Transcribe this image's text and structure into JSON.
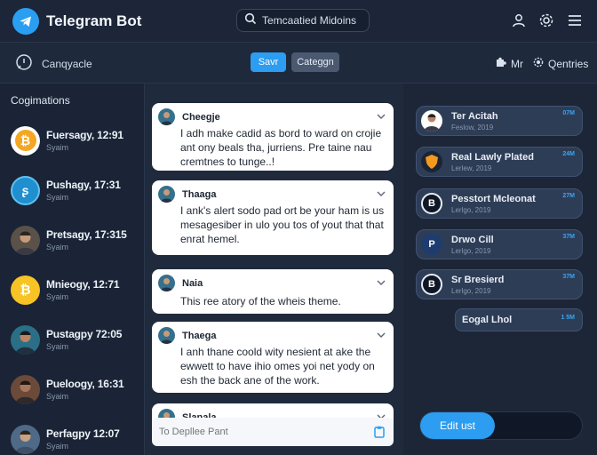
{
  "header": {
    "app_title": "Telegram Bot",
    "search_value": "Temcaatied Midoins",
    "icons": [
      "user-icon",
      "settings-icon",
      "menu-icon"
    ]
  },
  "subbar": {
    "label": "Canqyacle",
    "save_label": "Savr",
    "category_label": "Categgn",
    "mr_label": "Mr",
    "gentries_label": "Qentries"
  },
  "sidebar": {
    "title": "Cogimations",
    "items": [
      {
        "name": "Fuersagy, 12:91",
        "sub": "Syaim",
        "avatar": "coin"
      },
      {
        "name": "Pushagy, 17:31",
        "sub": "Syaim",
        "avatar": "logo"
      },
      {
        "name": "Pretsagy, 17:315",
        "sub": "Syaim",
        "avatar": "person"
      },
      {
        "name": "Mnieogy, 12:71",
        "sub": "Syaim",
        "avatar": "coin"
      },
      {
        "name": "Pustagpy 72:05",
        "sub": "Syaim",
        "avatar": "person"
      },
      {
        "name": "Pueloogy, 16:31",
        "sub": "Syaim",
        "avatar": "person"
      },
      {
        "name": "Perfagpy 12:07",
        "sub": "Syaim",
        "avatar": "person"
      }
    ]
  },
  "messages": [
    {
      "name": "Cheegje",
      "text": "I adh make cadid as bord to ward on crojie ant ony beals tha, jurriens. Pre taine nau cremtnes to tunge..!"
    },
    {
      "name": "Thaaga",
      "text": "I ank's alert sodo pad ort be your ham is us mesagesiber in ulo you tos of yout that that enrat hemel."
    },
    {
      "name": "Naia",
      "text": "This ree atory of the wheis theme."
    },
    {
      "name": "Thaega",
      "text": "I anh thane coold wity nesient at ake the ewwett to have ihio omes yoi net yody on esh the back ane of the work."
    },
    {
      "name": "Slanala",
      "text": ""
    }
  ],
  "composer": {
    "placeholder": "To Depllee Pant"
  },
  "right_panel": {
    "items": [
      {
        "title": "Ter Acitah",
        "sub": "Feslow, 2019",
        "time": "07M",
        "avatar": "person"
      },
      {
        "title": "Real Lawly Plated",
        "sub": "Lerlew, 2019",
        "time": "24M",
        "avatar": "shield"
      },
      {
        "title": "Pesstort Mcleonat",
        "sub": "Lerlgo, 2019",
        "time": "27M",
        "avatar": "letter-b"
      },
      {
        "title": "Drwo Cill",
        "sub": "Lerlgo, 2019",
        "time": "37M",
        "avatar": "letter-p"
      },
      {
        "title": "Sr Bresierd",
        "sub": "Lerlgo, 2019",
        "time": "37M",
        "avatar": "letter-b"
      }
    ],
    "small_item": {
      "title": "Eogal Lhol",
      "time": "1 5M"
    },
    "edit_label": "Edit ust"
  },
  "colors": {
    "accent": "#2c9df0",
    "background": "#1b2638",
    "panel": "#2e3d56"
  }
}
